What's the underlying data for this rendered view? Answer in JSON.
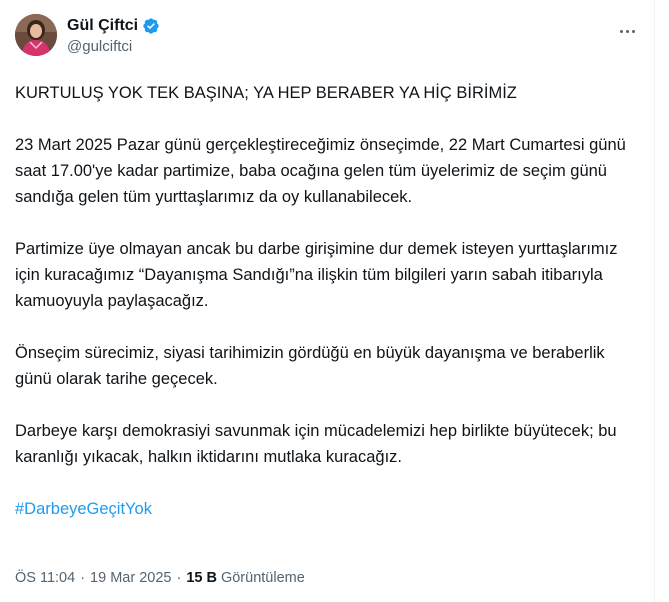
{
  "author": {
    "display_name": "Gül Çiftci",
    "handle": "@gulciftci",
    "verified_icon": "verified-badge-icon",
    "avatar_icon": "profile-photo"
  },
  "menu": {
    "more_icon": "more-options-icon"
  },
  "tweet": {
    "paragraphs": [
      "KURTULUŞ YOK TEK BAŞINA; YA HEP BERABER YA HİÇ BİRİMİZ",
      "23 Mart 2025 Pazar günü gerçekleştireceğimiz önseçimde, 22 Mart Cumartesi günü saat 17.00'ye kadar partimize, baba ocağına gelen tüm üyelerimiz de seçim günü sandığa gelen tüm yurttaşlarımız da oy kullanabilecek.",
      "Partimize üye olmayan ancak bu darbe girişimine dur demek isteyen yurttaşlarımız için kuracağımız “Dayanışma Sandığı”na ilişkin tüm bilgileri yarın sabah itibarıyla kamuoyuyla paylaşacağız.",
      "Önseçim sürecimiz, siyasi tarihimizin gördüğü en büyük dayanışma ve beraberlik günü olarak tarihe geçecek.",
      "Darbeye karşı demokrasiyi savunmak için mücadelemizi hep birlikte büyütecek; bu karanlığı yıkacak, halkın iktidarını mutlaka kuracağız."
    ],
    "hashtag": "#DarbeyeGeçitYok"
  },
  "meta": {
    "time": "ÖS 11:04",
    "separator": "·",
    "date": "19 Mar 2025",
    "views_count": "15 B",
    "views_label": "Görüntüleme"
  },
  "colors": {
    "link": "#1d9bf0",
    "text": "#0f1419",
    "secondary": "#536471",
    "verified": "#1d9bf0"
  }
}
